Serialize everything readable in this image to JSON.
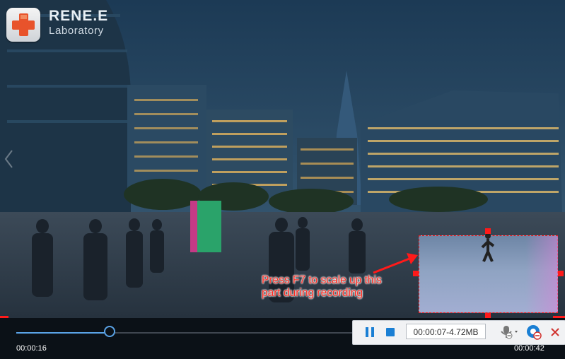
{
  "brand": {
    "name": "RENE.E",
    "subtitle": "Laboratory",
    "icon": "plus-cross-icon",
    "accent": "#e8532b"
  },
  "overlay": {
    "annotation": "Press F7 to scale up this part during recording",
    "annotation_color": "#ff2a20",
    "selection_color": "#ff1a1a"
  },
  "playback": {
    "elapsed": "00:00:16",
    "total": "00:00:42",
    "progress": 0.275
  },
  "recorder": {
    "pause_icon": "pause-icon",
    "stop_icon": "stop-icon",
    "readout": "00:00:07-4.72MB",
    "mic_icon": "microphone-icon",
    "camera_icon": "webcam-icon",
    "close_icon": "close-icon",
    "accent": "#1a7fd4"
  }
}
